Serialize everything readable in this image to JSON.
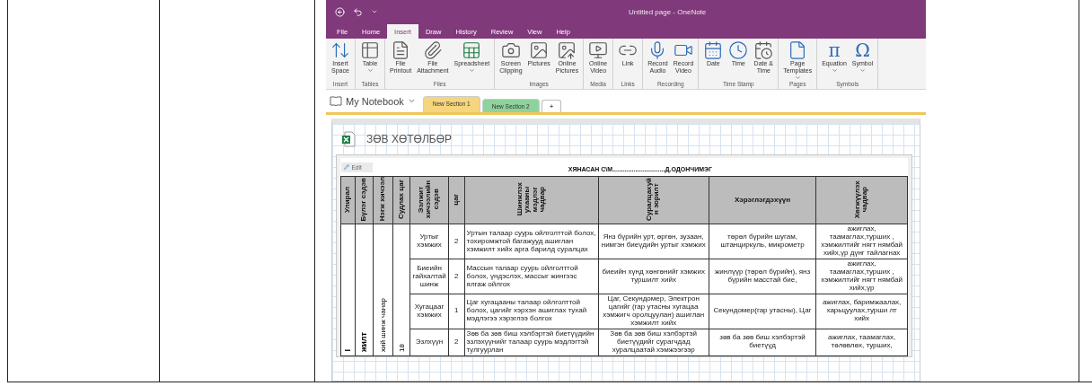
{
  "window": {
    "title": "Untitled page  -  OneNote"
  },
  "ribbon_tabs": [
    {
      "label": "File",
      "selected": false
    },
    {
      "label": "Home",
      "selected": false
    },
    {
      "label": "Insert",
      "selected": true
    },
    {
      "label": "Draw",
      "selected": false
    },
    {
      "label": "History",
      "selected": false
    },
    {
      "label": "Review",
      "selected": false
    },
    {
      "label": "View",
      "selected": false
    },
    {
      "label": "Help",
      "selected": false
    }
  ],
  "ribbon_groups": [
    {
      "label": "Insert",
      "buttons": [
        {
          "kind": "spacer",
          "lines": [
            "Insert",
            "Space"
          ],
          "dropdown": false
        }
      ]
    },
    {
      "label": "Tables",
      "buttons": [
        {
          "kind": "table",
          "lines": [
            "Table"
          ],
          "dropdown": true
        }
      ]
    },
    {
      "label": "Files",
      "buttons": [
        {
          "kind": "printout",
          "lines": [
            "File",
            "Printout"
          ],
          "dropdown": false
        },
        {
          "kind": "attachment",
          "lines": [
            "File",
            "Attachment"
          ],
          "dropdown": false
        },
        {
          "kind": "spreadsheet",
          "lines": [
            "Spreadsheet"
          ],
          "dropdown": true
        }
      ]
    },
    {
      "label": "Images",
      "buttons": [
        {
          "kind": "clipping",
          "lines": [
            "Screen",
            "Clipping"
          ],
          "dropdown": false
        },
        {
          "kind": "pictures",
          "lines": [
            "Pictures"
          ],
          "dropdown": false
        },
        {
          "kind": "online",
          "lines": [
            "Online",
            "Pictures"
          ],
          "dropdown": false
        }
      ]
    },
    {
      "label": "Media",
      "buttons": [
        {
          "kind": "video",
          "lines": [
            "Online",
            "Video"
          ],
          "dropdown": false
        }
      ]
    },
    {
      "label": "Links",
      "buttons": [
        {
          "kind": "link",
          "lines": [
            "Link"
          ],
          "dropdown": false
        }
      ]
    },
    {
      "label": "Recording",
      "buttons": [
        {
          "kind": "audio",
          "lines": [
            "Record",
            "Audio"
          ],
          "dropdown": false
        },
        {
          "kind": "camera",
          "lines": [
            "Record",
            "Video"
          ],
          "dropdown": false
        }
      ]
    },
    {
      "label": "Time Stamp",
      "buttons": [
        {
          "kind": "date",
          "lines": [
            "Date"
          ],
          "dropdown": false
        },
        {
          "kind": "time",
          "lines": [
            "Time"
          ],
          "dropdown": false
        },
        {
          "kind": "datetime",
          "lines": [
            "Date &",
            "Time"
          ],
          "dropdown": false
        }
      ]
    },
    {
      "label": "Pages",
      "buttons": [
        {
          "kind": "template",
          "lines": [
            "Page",
            "Templates"
          ],
          "dropdown": true
        }
      ]
    },
    {
      "label": "Symbols",
      "buttons": [
        {
          "kind": "glyph",
          "glyph": "π",
          "lines": [
            "Equation"
          ],
          "dropdown": true
        },
        {
          "kind": "glyph",
          "glyph": "Ω",
          "lines": [
            "Symbol"
          ],
          "dropdown": true
        }
      ]
    }
  ],
  "notebook": {
    "name": "My Notebook",
    "sections": [
      {
        "label": "New Section 1",
        "selected": true,
        "color": "#f5d57e"
      },
      {
        "label": "New Section 2",
        "selected": false,
        "color": "#8fd39c"
      }
    ],
    "add_tab": "+"
  },
  "page": {
    "title": "ЗӨВ ХӨТӨЛБӨР",
    "edit_label": "Edit",
    "sheet_title": "ХЯНАСАН С\\М..............................Д.ОДОНЧИМЭГ",
    "columns": [
      {
        "label": "Улирал",
        "rotated": true
      },
      {
        "label": "Бүлэг сэдэв",
        "rotated": true
      },
      {
        "label": "Нэгж хичээл",
        "rotated": true
      },
      {
        "label": "Судлах цаг",
        "rotated": true
      },
      {
        "label": "Ээлжит хичээлийн сэдэв",
        "rotated": true
      },
      {
        "label": "цаг",
        "rotated": true
      },
      {
        "label": "Шинжлэх ухааны мэдлэг чадвар",
        "rotated": true
      },
      {
        "label": "Суралцахуй н зорилт",
        "rotated": true
      },
      {
        "label": "Хэрэглэгдэхүүн",
        "rotated": false
      },
      {
        "label": "Хөгжүүлэх чадвар",
        "rotated": true
      }
    ],
    "rows": [
      {
        "cells": [
          {
            "text": "I",
            "rowspan": 4,
            "bold": true
          },
          {
            "text": "жилт",
            "rowspan": 4,
            "bold": true
          },
          {
            "text": "хий шинж чанар",
            "rowspan": 4,
            "bold": false
          },
          {
            "text": "18",
            "rowspan": 4,
            "bold": false
          },
          "Уртыг хэмжих",
          "2",
          "Уртын талаар суурь ойлголттой болох, тохиромжтой багажууд ашиглан хэмжилт хийх арга барилд суралцах",
          "Янз бүрийн урт, өргөн, зузаан, нимгэн биеүдийн уртыг хэмжих",
          "төрөл бүрийн шугам, штанциркуль, микрометр",
          "ажиглах, таамаглах,турших , хэмжилтийг нягт нямбай хийх,үр дүнг тайлагнах"
        ]
      },
      {
        "cells": [
          "Биеийн гайхалтай шинж",
          "2",
          "Массын талаар суурь ойлголттой болох, үндэслэх, массыг жингээс ялгаж ойлгох",
          "биеийн хүнд хөнгөнийг хэмжих туршилт хийх",
          "жинлүүр (төрөл бүрийн), янз бүрийн масстай бие,",
          "ажиглах, таамаглах,турших , хэмжилтийг нягт нямбай хийх,үр"
        ]
      },
      {
        "cells": [
          "Хугацааг хэмжих",
          "1",
          "Цаг хугацааны талаар ойлголттой болох, цагийг хэрхэн ашиглах тухай мэдлэгээ хэрэглээ болгох",
          "Цаг, Секундомер, Электрон цагийг (гар утасны хугацаа хэмжигч оролцуулан) ашиглан хэмжилт хийх",
          "Секундомер(гар утасны), Цаг",
          "ажиглах, баримжаалах, харьцуулах,турши лт хийх"
        ]
      },
      {
        "cells": [
          "Эзлхүүн",
          "2",
          "Зөв ба зөв биш хэлбэртэй биетүүдийн эзлэхүүнийг талаар суурь мэдлэгтэй тулгуурлан",
          "Зөв ба зөв биш хэлбэртэй биетүүдийг сурагчдад хуралцаатай хэмжээгээр",
          "зөв ба зөв биш хэлбэртэй биетүүд",
          "ажиглах, таамаглах, төлөвлөх, турших,"
        ]
      }
    ]
  }
}
